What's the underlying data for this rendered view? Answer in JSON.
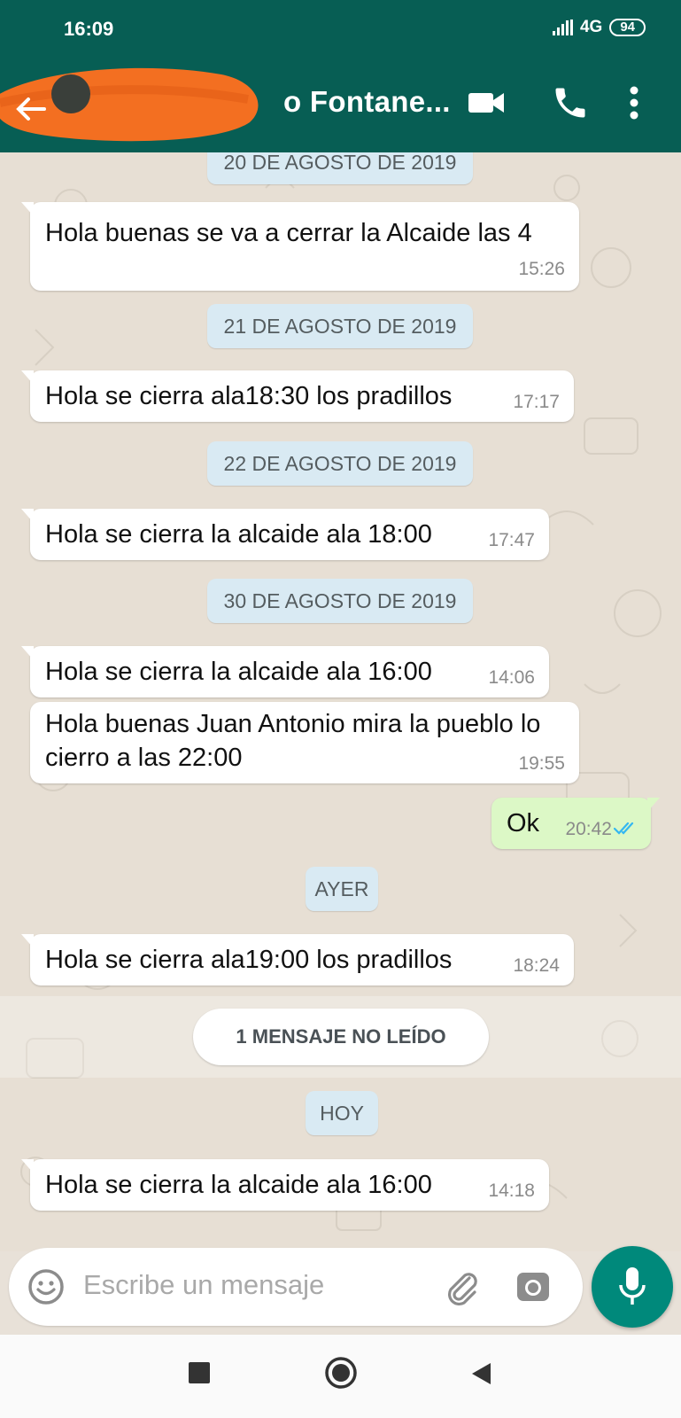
{
  "status_bar": {
    "time": "16:09",
    "network": "4G",
    "battery": "94"
  },
  "header": {
    "contact_name": "o Fontane...",
    "icons": [
      "back-arrow-icon",
      "avatar",
      "video-call-icon",
      "voice-call-icon",
      "more-vert-icon"
    ]
  },
  "messages": [
    {
      "type": "date",
      "text": "20 DE AGOSTO DE 2019"
    },
    {
      "type": "in",
      "text": "Hola buenas se va a cerrar la Alcaide las 4",
      "time": "15:26"
    },
    {
      "type": "date",
      "text": "21 DE AGOSTO DE 2019"
    },
    {
      "type": "in",
      "text": "Hola se cierra ala18:30 los pradillos",
      "time": "17:17"
    },
    {
      "type": "date",
      "text": "22 DE AGOSTO DE 2019"
    },
    {
      "type": "in",
      "text": "Hola se cierra la alcaide ala 18:00",
      "time": "17:47"
    },
    {
      "type": "date",
      "text": "30 DE AGOSTO DE 2019"
    },
    {
      "type": "in",
      "text": "Hola se cierra la alcaide ala 16:00",
      "time": "14:06"
    },
    {
      "type": "in",
      "text": "Hola buenas Juan Antonio mira la pueblo lo cierro a las 22:00",
      "time": "19:55"
    },
    {
      "type": "out",
      "text": "Ok",
      "time": "20:42",
      "status": "read"
    },
    {
      "type": "date",
      "text": "AYER"
    },
    {
      "type": "in",
      "text": "Hola se cierra ala19:00 los pradillos",
      "time": "18:24"
    },
    {
      "type": "unread",
      "text": "1 MENSAJE NO LEÍDO"
    },
    {
      "type": "date",
      "text": "HOY"
    },
    {
      "type": "in",
      "text": "Hola se cierra la alcaide ala 16:00",
      "time": "14:18"
    }
  ],
  "composer": {
    "placeholder": "Escribe un mensaje"
  },
  "colors": {
    "header": "#075e54",
    "outgoing_bubble": "#dcf8c6",
    "incoming_bubble": "#ffffff",
    "date_chip": "#d9eaf3",
    "mic_button": "#00897b",
    "read_ticks": "#34b7f1"
  }
}
